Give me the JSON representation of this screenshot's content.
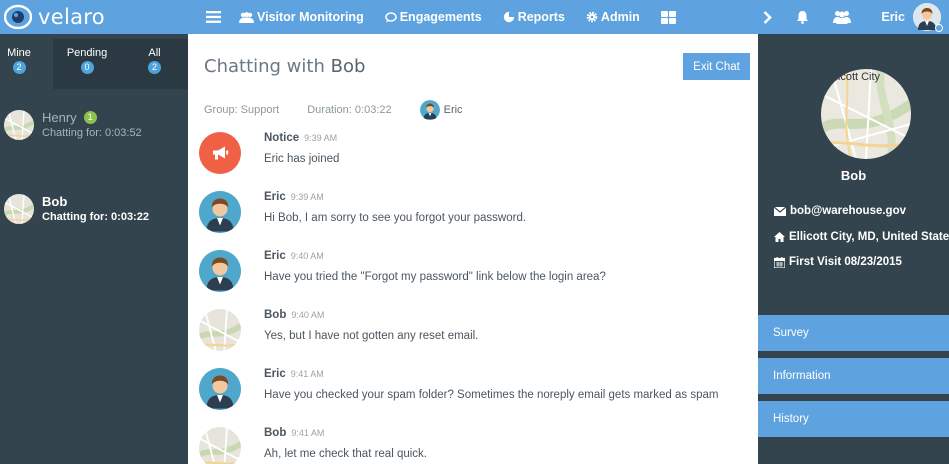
{
  "brand": {
    "name": "velaro"
  },
  "nav": {
    "items": [
      {
        "label": "Visitor Monitoring",
        "icon": "users-icon"
      },
      {
        "label": "Engagements",
        "icon": "chat-bubble-icon"
      },
      {
        "label": "Reports",
        "icon": "pie-chart-icon"
      },
      {
        "label": "Admin",
        "icon": "gear-icon"
      }
    ],
    "user": {
      "name": "Eric"
    }
  },
  "colors": {
    "accent": "#5ea3df",
    "sidebar": "#34444f",
    "notice": "#f06044",
    "badge_green": "#8bc34a"
  },
  "sidebar": {
    "tabs": [
      {
        "label": "Mine",
        "count": "2"
      },
      {
        "label": "Pending",
        "count": "0"
      },
      {
        "label": "All",
        "count": "2"
      }
    ],
    "chats": [
      {
        "name": "Henry",
        "unread": "1",
        "duration": "Chatting for: 0:03:52"
      },
      {
        "name": "Bob",
        "duration": "Chatting for: 0:03:22"
      }
    ]
  },
  "chat": {
    "title_prefix": "Chatting with ",
    "title_name": "Bob",
    "exit_label": "Exit Chat",
    "group": "Group: Support",
    "duration": "Duration: 0:03:22",
    "agent": "Eric",
    "messages": [
      {
        "author": "Notice",
        "time": "9:39 AM",
        "text": "Eric has joined"
      },
      {
        "author": "Eric",
        "time": "9:39 AM",
        "text": "Hi Bob, I am sorry to see you forgot your password."
      },
      {
        "author": "Eric",
        "time": "9:40 AM",
        "text": "Have you tried the \"Forgot my password\" link below the login area?"
      },
      {
        "author": "Bob",
        "time": "9:40 AM",
        "text": "Yes, but I have not gotten any reset email."
      },
      {
        "author": "Eric",
        "time": "9:41 AM",
        "text": "Have you checked your spam folder? Sometimes the noreply email gets marked as spam"
      },
      {
        "author": "Bob",
        "time": "9:41 AM",
        "text": "Ah, let me check that real quick."
      }
    ]
  },
  "visitor": {
    "name": "Bob",
    "map_label": "llicott City",
    "email": "bob@warehouse.gov",
    "location": "Ellicott City, MD, United States",
    "first_visit": "First Visit 08/23/2015",
    "sections": [
      "Survey",
      "Information",
      "History"
    ]
  }
}
